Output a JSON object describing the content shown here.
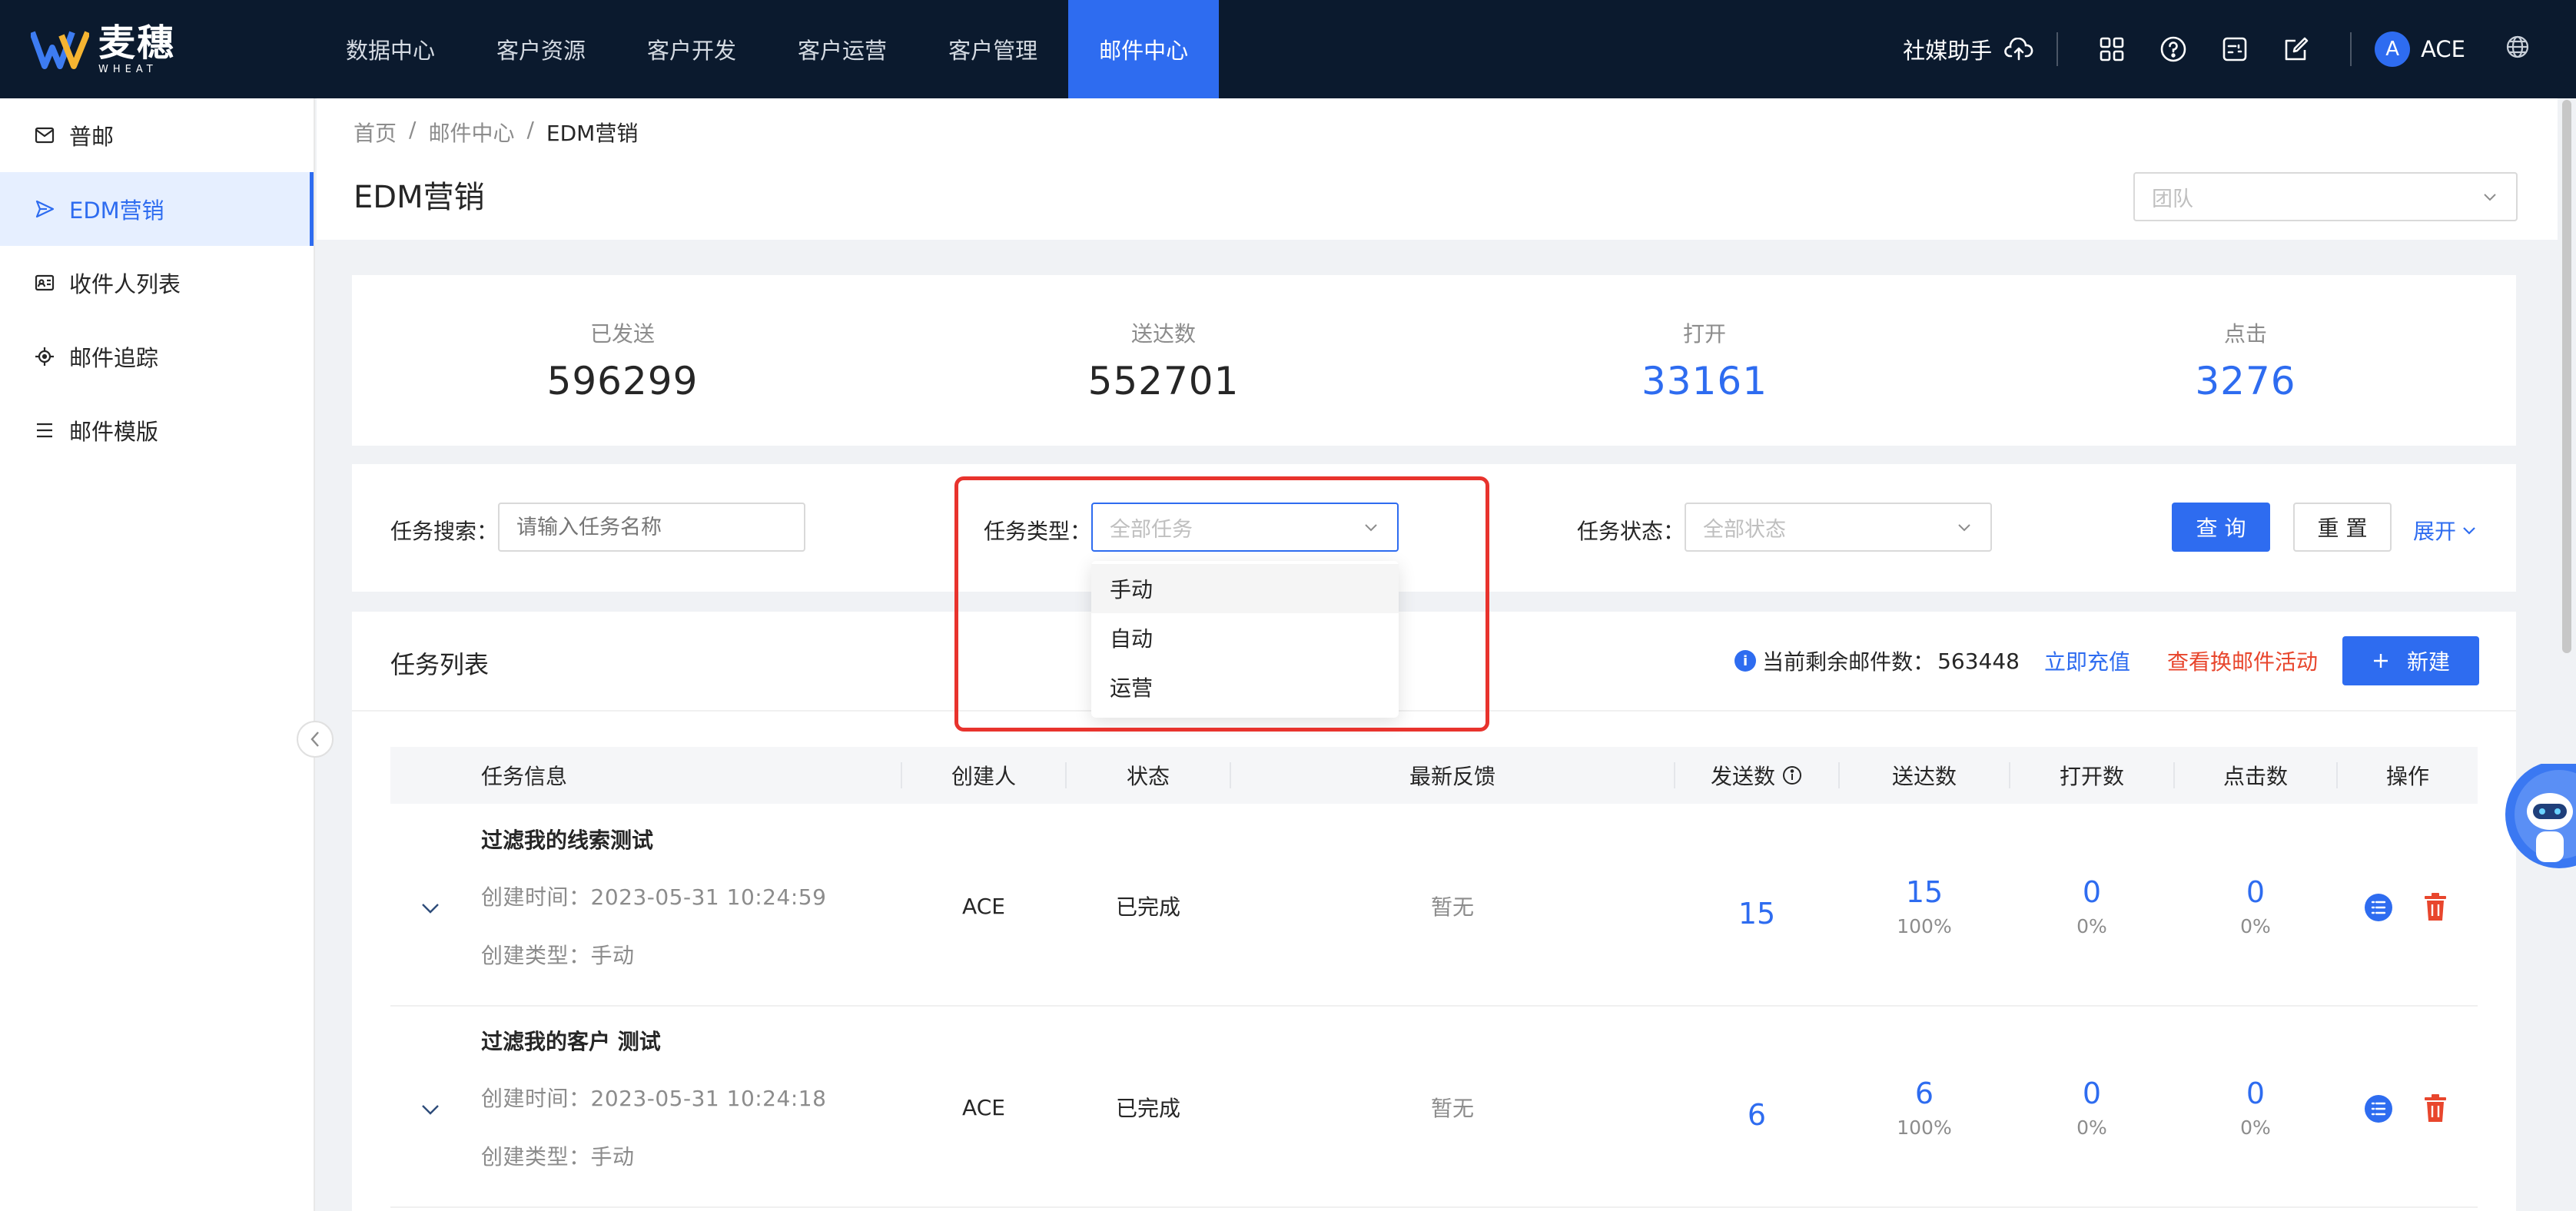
{
  "brand": {
    "name_cn": "麦穗",
    "name_en": "WHEAT"
  },
  "nav": {
    "items": [
      {
        "label": "数据中心",
        "active": false
      },
      {
        "label": "客户资源",
        "active": false
      },
      {
        "label": "客户开发",
        "active": false
      },
      {
        "label": "客户运营",
        "active": false
      },
      {
        "label": "客户管理",
        "active": false
      },
      {
        "label": "邮件中心",
        "active": true
      }
    ]
  },
  "topbar": {
    "helper_label": "社媒助手",
    "avatar_letter": "A",
    "username": "ACE"
  },
  "sidebar": {
    "items": [
      {
        "label": "普邮",
        "icon": "mail-icon",
        "active": false
      },
      {
        "label": "EDM营销",
        "icon": "send-icon",
        "active": true
      },
      {
        "label": "收件人列表",
        "icon": "id-card-icon",
        "active": false
      },
      {
        "label": "邮件追踪",
        "icon": "target-icon",
        "active": false
      },
      {
        "label": "邮件模版",
        "icon": "list-icon",
        "active": false
      }
    ]
  },
  "breadcrumb": {
    "items": [
      "首页",
      "邮件中心",
      "EDM营销"
    ],
    "sep": "/"
  },
  "page": {
    "title": "EDM营销",
    "team_placeholder": "团队"
  },
  "stats": [
    {
      "label": "已发送",
      "value": "596299",
      "highlight": false
    },
    {
      "label": "送达数",
      "value": "552701",
      "highlight": false
    },
    {
      "label": "打开",
      "value": "33161",
      "highlight": true
    },
    {
      "label": "点击",
      "value": "3276",
      "highlight": true
    }
  ],
  "filter": {
    "search_label": "任务搜索：",
    "search_placeholder": "请输入任务名称",
    "type_label": "任务类型：",
    "type_value": "全部任务",
    "status_label": "任务状态：",
    "status_value": "全部状态",
    "query_label": "查 询",
    "reset_label": "重 置",
    "expand_label": "展开"
  },
  "dropdown": {
    "options": [
      "手动",
      "自动",
      "运营"
    ]
  },
  "tasks": {
    "title": "任务列表",
    "remaining_label": "当前剩余邮件数：",
    "remaining_value": "563448",
    "recharge_label": "立即充值",
    "activity_label": "查看换邮件活动",
    "new_label": "新建",
    "columns": [
      "任务信息",
      "创建人",
      "状态",
      "最新反馈",
      "发送数",
      "送达数",
      "打开数",
      "点击数",
      "操作"
    ],
    "rows": [
      {
        "name": "过滤我的线索测试",
        "created": "创建时间：2023-05-31 10:24:59",
        "type": "创建类型：手动",
        "creator": "ACE",
        "status": "已完成",
        "feedback": "暂无",
        "sent": "15",
        "delivered": "15",
        "delivered_pct": "100%",
        "opened": "0",
        "opened_pct": "0%",
        "clicked": "0",
        "clicked_pct": "0%"
      },
      {
        "name": "过滤我的客户 测试",
        "created": "创建时间：2023-05-31 10:24:18",
        "type": "创建类型：手动",
        "creator": "ACE",
        "status": "已完成",
        "feedback": "暂无",
        "sent": "6",
        "delivered": "6",
        "delivered_pct": "100%",
        "opened": "0",
        "opened_pct": "0%",
        "clicked": "0",
        "clicked_pct": "0%"
      }
    ]
  },
  "colors": {
    "topbar": "#0b1a2e",
    "primary": "#2e6cf0",
    "danger": "#e8462d",
    "highlight_box": "#e8332d"
  }
}
